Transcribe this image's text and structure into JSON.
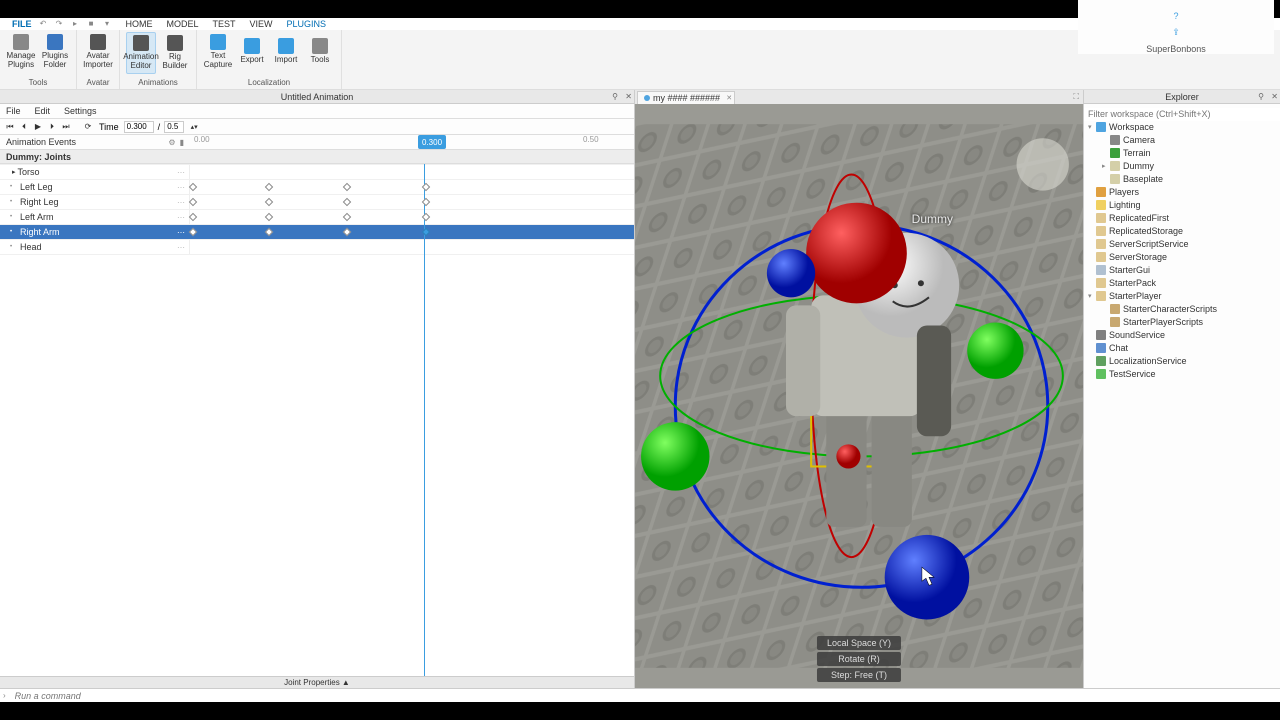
{
  "menubar": {
    "file": "FILE",
    "items": [
      "HOME",
      "MODEL",
      "TEST",
      "VIEW",
      "PLUGINS"
    ],
    "active": 4,
    "username": "SuperBonbons"
  },
  "ribbon": {
    "groups": [
      {
        "label": "Tools",
        "buttons": [
          {
            "name": "manage-plugins",
            "label": "Manage Plugins",
            "color": "#888"
          },
          {
            "name": "plugins-folder",
            "label": "Plugins Folder",
            "color": "#3a76c0"
          }
        ]
      },
      {
        "label": "Avatar",
        "buttons": [
          {
            "name": "avatar-importer",
            "label": "Avatar Importer",
            "color": "#555"
          }
        ]
      },
      {
        "label": "Animations",
        "buttons": [
          {
            "name": "animation-editor",
            "label": "Animation Editor",
            "color": "#555",
            "active": true
          },
          {
            "name": "rig-builder",
            "label": "Rig Builder",
            "color": "#555"
          }
        ]
      },
      {
        "label": "Localization",
        "buttons": [
          {
            "name": "text-capture",
            "label": "Text Capture",
            "color": "#3a9de0"
          },
          {
            "name": "export",
            "label": "Export",
            "color": "#3a9de0"
          },
          {
            "name": "import",
            "label": "Import",
            "color": "#3a9de0"
          },
          {
            "name": "tools",
            "label": "Tools",
            "color": "#888"
          }
        ]
      }
    ]
  },
  "animation_panel": {
    "title": "Untitled Animation",
    "menu": [
      "File",
      "Edit",
      "Settings"
    ],
    "time_label": "Time",
    "time_value": "0.300",
    "length_value": "0.5",
    "events_label": "Animation Events",
    "joints_header": "Dummy: Joints",
    "joint_props": "Joint Properties  ▲",
    "ticks": [
      {
        "pos": 4,
        "label": "0.00"
      },
      {
        "pos": 393,
        "label": "0.50"
      }
    ],
    "playhead": {
      "pos": 228,
      "label": "0.300"
    },
    "tracks": [
      {
        "name": "Torso",
        "indent": false,
        "keys": []
      },
      {
        "name": "Left Leg",
        "indent": true,
        "keys": [
          0,
          76,
          154,
          233
        ]
      },
      {
        "name": "Right Leg",
        "indent": true,
        "keys": [
          0,
          76,
          154,
          233
        ]
      },
      {
        "name": "Left Arm",
        "indent": true,
        "keys": [
          0,
          76,
          154,
          233
        ]
      },
      {
        "name": "Right Arm",
        "indent": true,
        "selected": true,
        "keys": [
          0,
          76,
          154,
          233
        ]
      },
      {
        "name": "Head",
        "indent": true,
        "keys": []
      }
    ],
    "event_keys": [
      0,
      76,
      154,
      233
    ]
  },
  "viewport": {
    "tab_label": "my #### ######",
    "character_label": "Dummy",
    "hud": [
      "Local Space (Y)",
      "Rotate (R)",
      "Step: Free (T)"
    ]
  },
  "explorer": {
    "title": "Explorer",
    "filter_placeholder": "Filter workspace (Ctrl+Shift+X)",
    "tree": [
      {
        "d": 0,
        "arrow": "▾",
        "icon": "ic-ws",
        "label": "Workspace"
      },
      {
        "d": 1,
        "arrow": "",
        "icon": "ic-cam",
        "label": "Camera"
      },
      {
        "d": 1,
        "arrow": "",
        "icon": "ic-terr",
        "label": "Terrain"
      },
      {
        "d": 1,
        "arrow": "▸",
        "icon": "ic-model",
        "label": "Dummy"
      },
      {
        "d": 1,
        "arrow": "",
        "icon": "ic-base",
        "label": "Baseplate"
      },
      {
        "d": 0,
        "arrow": "",
        "icon": "ic-players",
        "label": "Players"
      },
      {
        "d": 0,
        "arrow": "",
        "icon": "ic-light",
        "label": "Lighting"
      },
      {
        "d": 0,
        "arrow": "",
        "icon": "ic-rf",
        "label": "ReplicatedFirst"
      },
      {
        "d": 0,
        "arrow": "",
        "icon": "ic-rs",
        "label": "ReplicatedStorage"
      },
      {
        "d": 0,
        "arrow": "",
        "icon": "ic-sss",
        "label": "ServerScriptService"
      },
      {
        "d": 0,
        "arrow": "",
        "icon": "ic-ss",
        "label": "ServerStorage"
      },
      {
        "d": 0,
        "arrow": "",
        "icon": "ic-sg",
        "label": "StarterGui"
      },
      {
        "d": 0,
        "arrow": "",
        "icon": "ic-sp",
        "label": "StarterPack"
      },
      {
        "d": 0,
        "arrow": "▾",
        "icon": "ic-spl",
        "label": "StarterPlayer"
      },
      {
        "d": 1,
        "arrow": "",
        "icon": "ic-scs",
        "label": "StarterCharacterScripts"
      },
      {
        "d": 1,
        "arrow": "",
        "icon": "ic-sps",
        "label": "StarterPlayerScripts"
      },
      {
        "d": 0,
        "arrow": "",
        "icon": "ic-snd",
        "label": "SoundService"
      },
      {
        "d": 0,
        "arrow": "",
        "icon": "ic-chat",
        "label": "Chat"
      },
      {
        "d": 0,
        "arrow": "",
        "icon": "ic-loc",
        "label": "LocalizationService"
      },
      {
        "d": 0,
        "arrow": "",
        "icon": "ic-test",
        "label": "TestService"
      }
    ]
  },
  "commandbar": {
    "placeholder": "Run a command"
  }
}
